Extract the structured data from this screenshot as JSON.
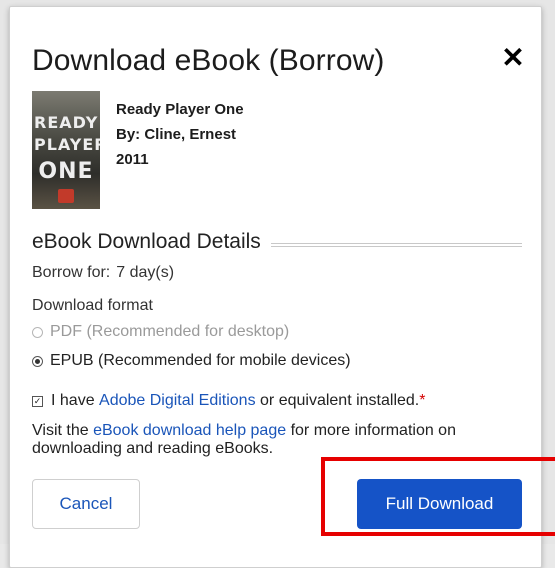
{
  "dialog": {
    "title": "Download eBook (Borrow)",
    "close_symbol": "✕"
  },
  "book": {
    "title": "Ready Player One",
    "author": "By: Cline, Ernest",
    "year": "2011",
    "cover_words": [
      "READY",
      "PLAYER",
      "ONE"
    ]
  },
  "details": {
    "heading": "eBook Download Details",
    "borrow_label": "Borrow for:",
    "borrow_value": "7 day(s)",
    "format_label": "Download format",
    "options": [
      {
        "label": "PDF (Recommended for desktop)",
        "selected": false,
        "enabled": false
      },
      {
        "label": "EPUB (Recommended for mobile devices)",
        "selected": true,
        "enabled": true
      }
    ]
  },
  "agreement": {
    "checked": true,
    "prefix": "I have ",
    "link": "Adobe Digital Editions",
    "suffix": " or equivalent installed.",
    "required_mark": "*"
  },
  "help": {
    "prefix": "Visit the ",
    "link": "eBook download help page",
    "suffix": " for more information on downloading and reading eBooks."
  },
  "buttons": {
    "cancel": "Cancel",
    "full_download": "Full Download"
  },
  "colors": {
    "primary": "#1553c7",
    "link": "#1a55b9",
    "highlight": "#e60000",
    "required": "#d40000"
  }
}
